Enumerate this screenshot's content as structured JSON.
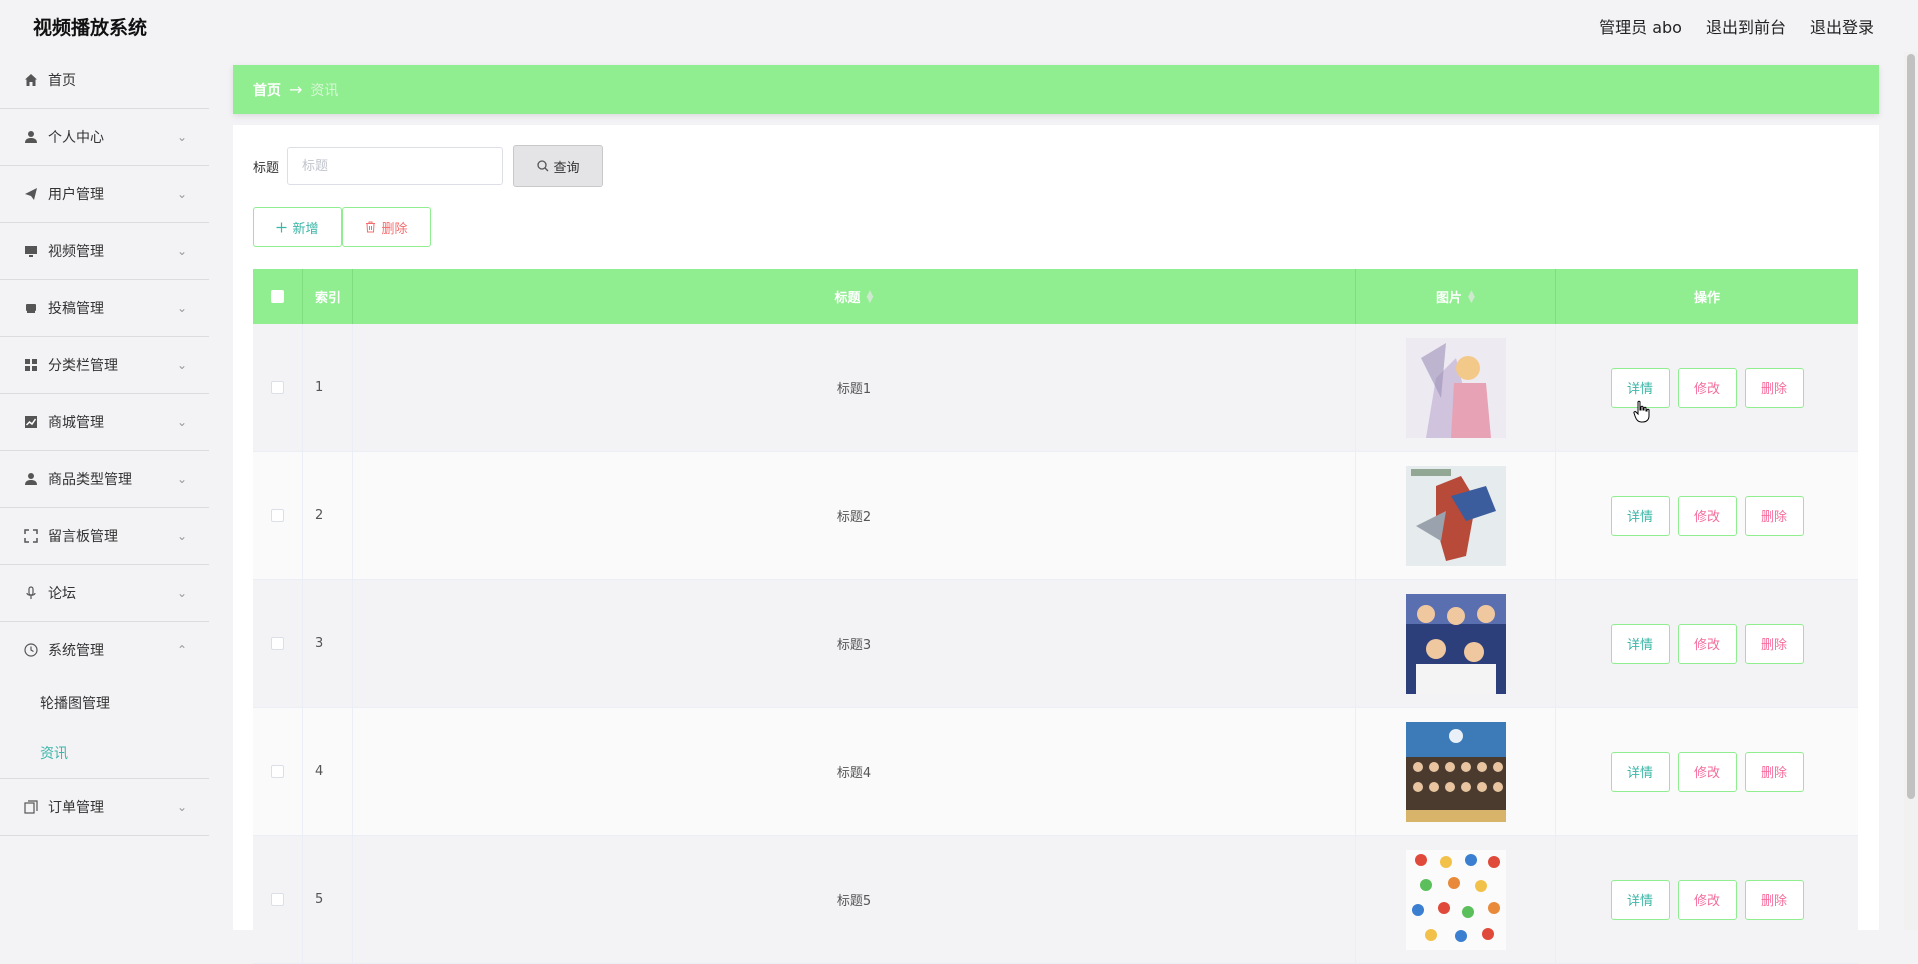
{
  "app": {
    "title": "视频播放系统"
  },
  "header": {
    "user": "管理员 abo",
    "to_front": "退出到前台",
    "logout": "退出登录"
  },
  "sidebar": {
    "items": [
      {
        "label": "首页",
        "icon": "home-icon"
      },
      {
        "label": "个人中心",
        "icon": "user-icon"
      },
      {
        "label": "用户管理",
        "icon": "send-icon"
      },
      {
        "label": "视频管理",
        "icon": "monitor-icon"
      },
      {
        "label": "投稿管理",
        "icon": "printer-icon"
      },
      {
        "label": "分类栏管理",
        "icon": "grid-icon"
      },
      {
        "label": "商城管理",
        "icon": "chart-icon"
      },
      {
        "label": "商品类型管理",
        "icon": "user-icon"
      },
      {
        "label": "留言板管理",
        "icon": "fullscreen-icon"
      },
      {
        "label": "论坛",
        "icon": "microphone-icon"
      },
      {
        "label": "系统管理",
        "icon": "clock-icon"
      },
      {
        "label": "订单管理",
        "icon": "copy-icon"
      }
    ],
    "submenu": [
      {
        "label": "轮播图管理"
      },
      {
        "label": "资讯"
      }
    ]
  },
  "breadcrumb": {
    "home": "首页",
    "arrow": "→",
    "current": "资讯"
  },
  "search": {
    "label": "标题",
    "placeholder": "标题",
    "value": "",
    "button": "查询"
  },
  "actions": {
    "add": "新增",
    "delete": "删除"
  },
  "table": {
    "headers": {
      "index": "索引",
      "title": "标题",
      "image": "图片",
      "operation": "操作"
    },
    "rows": [
      {
        "index": "1",
        "title": "标题1"
      },
      {
        "index": "2",
        "title": "标题2"
      },
      {
        "index": "3",
        "title": "标题3"
      },
      {
        "index": "4",
        "title": "标题4"
      },
      {
        "index": "5",
        "title": "标题5"
      }
    ],
    "row_actions": {
      "detail": "详情",
      "edit": "修改",
      "delete": "删除"
    }
  },
  "colors": {
    "accent": "#90ee90",
    "teal": "#3ab6a7",
    "danger": "#f56c6c",
    "pink": "#f56c9c"
  }
}
